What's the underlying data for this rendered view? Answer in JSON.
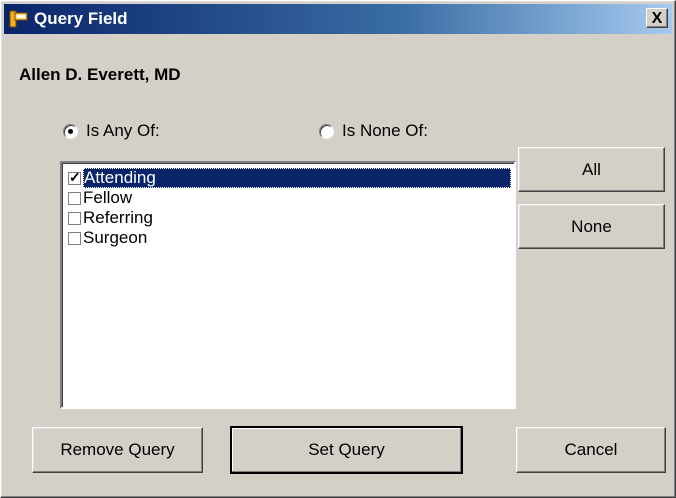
{
  "window": {
    "title": "Query Field",
    "close_glyph": "X",
    "app_icon": "query-field-app-icon"
  },
  "record_name": "Allen D. Everett, MD",
  "radios": [
    {
      "label": "Is Any Of:",
      "checked": true
    },
    {
      "label": "Is None Of:",
      "checked": false
    }
  ],
  "list": {
    "items": [
      {
        "label": "Attending",
        "checked": true,
        "selected": true
      },
      {
        "label": "Fellow",
        "checked": false,
        "selected": false
      },
      {
        "label": "Referring",
        "checked": false,
        "selected": false
      },
      {
        "label": "Surgeon",
        "checked": false,
        "selected": false
      }
    ]
  },
  "buttons": {
    "all": "All",
    "none": "None",
    "remove_query": "Remove Query",
    "set_query": "Set Query",
    "cancel": "Cancel"
  }
}
